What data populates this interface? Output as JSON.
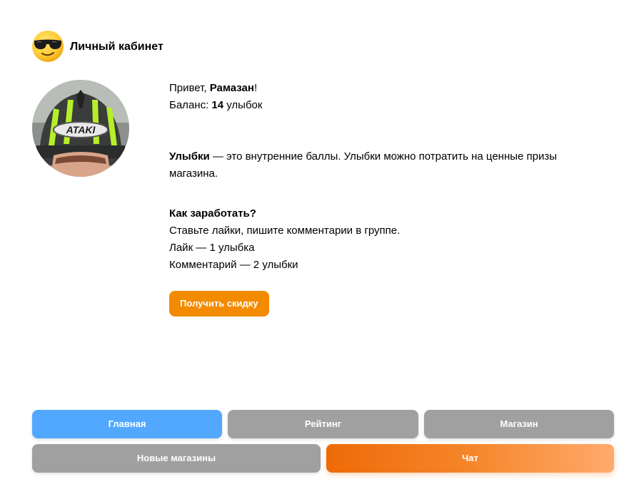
{
  "header": {
    "title": "Личный кабинет",
    "icon": "sunglasses-emoji-icon"
  },
  "profile": {
    "avatar": "user-avatar",
    "helmet_text": "ATAKI",
    "greeting_prefix": "Привет, ",
    "user_name": "Рамазан",
    "greeting_suffix": "!",
    "balance_prefix": "Баланс: ",
    "balance_value": "14",
    "balance_suffix": " улыбок"
  },
  "info": {
    "smiles_term": "Улыбки",
    "smiles_description": " — это внутренние баллы. Улыбки можно потратить на ценные призы магазина.",
    "earn_title": "Как заработать?",
    "earn_line_1": "Ставьте лайки, пишите комментарии в группе.",
    "earn_line_2": "Лайк — 1 улыбка",
    "earn_line_3": "Комментарий — 2 улыбки",
    "discount_button": "Получить скидку"
  },
  "nav": {
    "home": "Главная",
    "rating": "Рейтинг",
    "shop": "Магазин",
    "new_shops": "Новые магазины",
    "chat": "Чат"
  },
  "colors": {
    "accent_orange": "#f38b00",
    "active_blue": "#52a8ff",
    "inactive_gray": "#a0a0a0"
  }
}
